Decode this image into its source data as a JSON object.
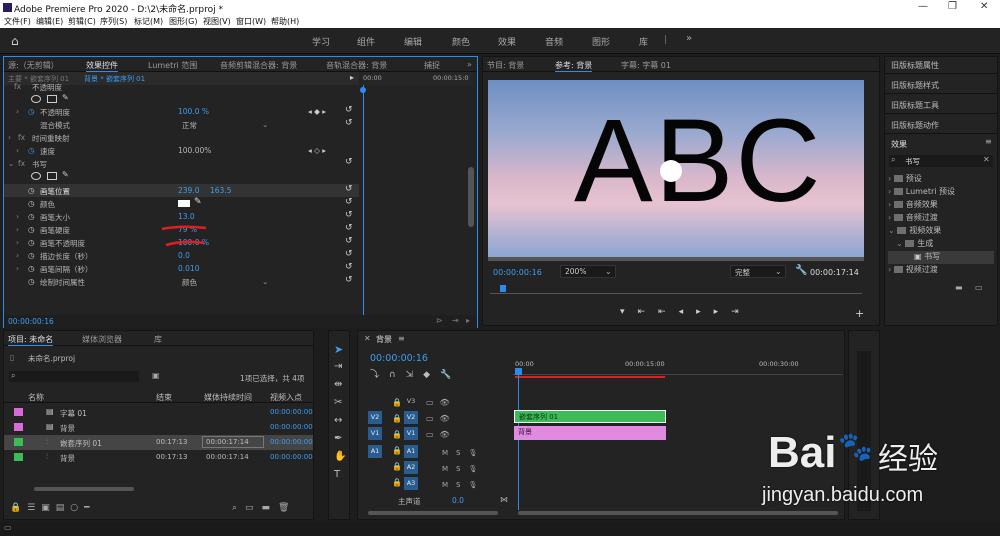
{
  "app": {
    "title": "Adobe Premiere Pro 2020 - D:\\2\\未命名.prproj *"
  },
  "menu": [
    "文件(F)",
    "编辑(E)",
    "剪辑(C)",
    "序列(S)",
    "标记(M)",
    "图形(G)",
    "视图(V)",
    "窗口(W)",
    "帮助(H)"
  ],
  "workspaces": [
    "学习",
    "组件",
    "编辑",
    "颜色",
    "效果",
    "音频",
    "图形",
    "库"
  ],
  "source_panel": {
    "tabs": [
      "源:（无剪辑）",
      "效果控件",
      "Lumetri 范围",
      "音频剪辑混合器: 背景",
      "音轨混合器: 背景",
      "捕捉"
    ],
    "master_label": "主要 * 嵌套序列 01",
    "clip_label": "背景 * 嵌套序列 01",
    "ruler_start": "00:00",
    "ruler_end": "00:00:15:0",
    "rows": [
      {
        "label": "不透明度",
        "value": "",
        "value2": "",
        "indent": "fx"
      },
      {
        "label": "不透明度",
        "value": "100.0 %",
        "value2": "",
        "indent": "sub"
      },
      {
        "label": "混合模式",
        "value": "正常",
        "value2": "",
        "indent": "sub"
      },
      {
        "label": "时间重映射",
        "value": "",
        "value2": "",
        "indent": "fx"
      },
      {
        "label": "速度",
        "value": "100.00%",
        "value2": "",
        "indent": "sub"
      },
      {
        "label": "书写",
        "value": "",
        "value2": "",
        "indent": "fx"
      },
      {
        "label": "画笔位置",
        "value": "239.0",
        "value2": "163.5",
        "indent": "sub"
      },
      {
        "label": "颜色",
        "value": "",
        "value2": "",
        "indent": "sub"
      },
      {
        "label": "画笔大小",
        "value": "13.0",
        "value2": "",
        "indent": "sub"
      },
      {
        "label": "画笔硬度",
        "value": "79 %",
        "value2": "",
        "indent": "sub"
      },
      {
        "label": "画笔不透明度",
        "value": "100.0 %",
        "value2": "",
        "indent": "sub"
      },
      {
        "label": "描边长度（秒）",
        "value": "0.0",
        "value2": "",
        "indent": "sub"
      },
      {
        "label": "画笔间隔（秒）",
        "value": "0.010",
        "value2": "",
        "indent": "sub"
      },
      {
        "label": "绘制时间属性",
        "value": "颜色",
        "value2": "",
        "indent": "sub"
      }
    ],
    "timecode": "00:00:00:16"
  },
  "program": {
    "tabs": [
      "节目: 背景",
      "参考: 背景",
      "字幕: 字幕 01"
    ],
    "text": "ABC",
    "timecode": "00:00:00:16",
    "zoom": "200%",
    "quality": "完整",
    "duration": "00:00:17:14"
  },
  "right_panel": {
    "items": [
      "旧版标题属性",
      "旧版标题样式",
      "旧版标题工具",
      "旧版标题动作"
    ],
    "effects_title": "效果",
    "search": "书写",
    "tree": [
      {
        "label": "预设",
        "level": 0
      },
      {
        "label": "Lumetri 预设",
        "level": 0
      },
      {
        "label": "音频效果",
        "level": 0
      },
      {
        "label": "音频过渡",
        "level": 0
      },
      {
        "label": "视频效果",
        "level": 0
      },
      {
        "label": "生成",
        "level": 1
      },
      {
        "label": "书写",
        "level": 2
      },
      {
        "label": "视频过渡",
        "level": 0
      }
    ]
  },
  "project": {
    "tabs": [
      "项目: 未命名",
      "媒体浏览器",
      "库"
    ],
    "filename": "未命名.prproj",
    "selection": "1项已选择，共 4项",
    "columns": [
      "名称",
      "结束",
      "媒体持续时间",
      "视频入点"
    ],
    "rows": [
      {
        "name": "字幕 01",
        "end": "",
        "dur": "",
        "in": "00:00:00:00",
        "color": "#d96ad8"
      },
      {
        "name": "背景",
        "end": "",
        "dur": "",
        "in": "00:00:00:00",
        "color": "#d96ad8"
      },
      {
        "name": "嵌套序列 01",
        "end": "00:17:13",
        "dur": "00:00:17:14",
        "in": "00:00:00:00",
        "color": "#3dbb57"
      },
      {
        "name": "背景",
        "end": "00:17:13",
        "dur": "00:00:17:14",
        "in": "00:00:00:00",
        "color": "#3dbb57"
      }
    ]
  },
  "timeline": {
    "tab": "背景",
    "timecode": "00:00:00:16",
    "ruler": [
      "00:00",
      "00:00:15:00",
      "00:00:30:00"
    ],
    "tracks": [
      "V3",
      "V2",
      "V1",
      "A1",
      "A2",
      "A3"
    ],
    "master_label": "主声道",
    "master_value": "0.0",
    "clips": [
      {
        "label": "嵌套序列 01",
        "track": "V2",
        "color": "#3dbb57"
      },
      {
        "label": "背景",
        "track": "V1",
        "color": "#e08ae0"
      }
    ]
  },
  "colors": {
    "accent": "#2d8ceb",
    "green": "#3dbb57",
    "pink": "#e08ae0",
    "annotation": "#e02020"
  },
  "watermark": {
    "line1": "Bai",
    "line2": "经验",
    "url": "jingyan.baidu.com"
  }
}
